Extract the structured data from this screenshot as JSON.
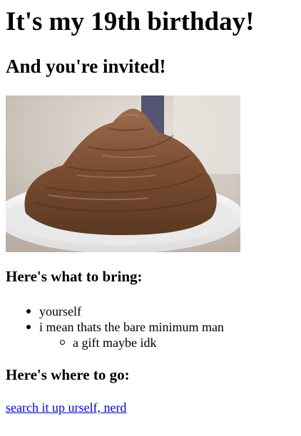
{
  "heading": {
    "title": "It's my 19th birthday!",
    "subtitle": "And you're invited!"
  },
  "image": {
    "subject": "chocolate-frosted-cake",
    "colors": {
      "frosting_dark": "#5e3a24",
      "frosting_mid": "#8a5a3b",
      "frosting_light": "#a87556",
      "plate": "#f3f3f3",
      "background": "#d9d4cf"
    }
  },
  "bring": {
    "heading": "Here's what to bring:",
    "items": [
      {
        "label": "yourself"
      },
      {
        "label": "i mean thats the bare minimum man"
      }
    ],
    "subitems": [
      {
        "label": "a gift maybe idk"
      }
    ]
  },
  "location": {
    "heading": "Here's where to go:",
    "link_text": "search it up urself, nerd"
  },
  "colors": {
    "link": "#0000ee",
    "text": "#000000",
    "background": "#ffffff"
  }
}
